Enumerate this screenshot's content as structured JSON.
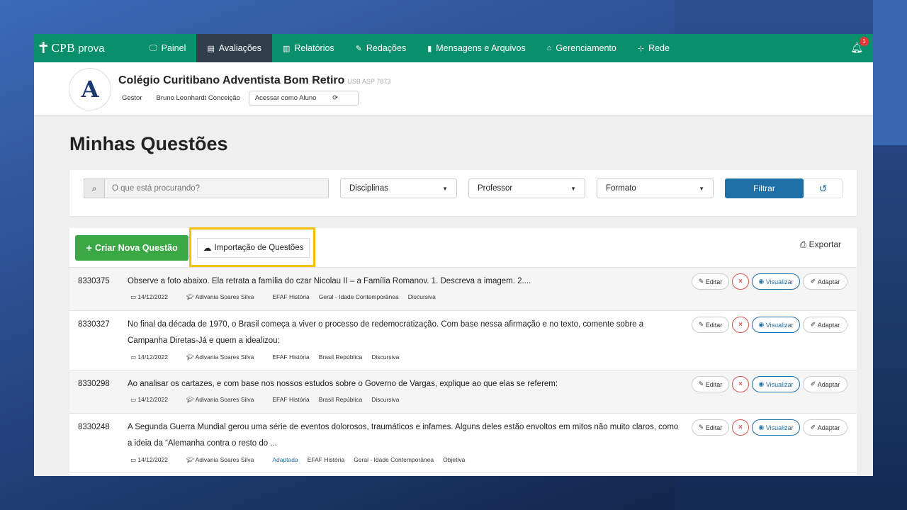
{
  "nav": {
    "logo_cpb": "CPB",
    "logo_prova": "prova",
    "items": [
      {
        "label": "Painel",
        "icon": "monitor-icon",
        "glyph": "🖵"
      },
      {
        "label": "Avaliações",
        "icon": "document-icon",
        "glyph": "▤"
      },
      {
        "label": "Relatórios",
        "icon": "bar-chart-icon",
        "glyph": "▥"
      },
      {
        "label": "Redações",
        "icon": "pencil-icon",
        "glyph": "✎"
      },
      {
        "label": "Mensagens e Arquivos",
        "icon": "book-icon",
        "glyph": "▮"
      },
      {
        "label": "Gerenciamento",
        "icon": "building-icon",
        "glyph": "⌂"
      },
      {
        "label": "Rede",
        "icon": "sitemap-icon",
        "glyph": "⊹"
      }
    ],
    "notification_count": "1",
    "accent": "#0a8f6b"
  },
  "school": {
    "name": "Colégio Curitibano Adventista Bom Retiro",
    "code": "USB ASP 7873",
    "role": "Gestor",
    "user": "Bruno Leonhardt Conceição",
    "access_button": "Acessar como Aluno"
  },
  "page": {
    "title": "Minhas Questões"
  },
  "filters": {
    "search_placeholder": "O que está procurando?",
    "disciplinas": "Disciplinas",
    "professor": "Professor",
    "formato": "Formato",
    "filter_button": "Filtrar"
  },
  "actions": {
    "create": "Criar Nova Questão",
    "import": "Importação de Questões",
    "export": "Exportar"
  },
  "row_buttons": {
    "edit": "Editar",
    "delete": "×",
    "view": "Visualizar",
    "adapt": "Adaptar"
  },
  "questions": [
    {
      "id": "8330375",
      "text": "Observe a foto abaixo. Ela retrata a família do czar Nicolau II – a Família Romanov.   1. Descreva a imagem.  2....",
      "date": "14/12/2022",
      "author": "Adivania Soares Silva",
      "adapted": "",
      "subject": "EFAF História",
      "topic": "Geral - Idade Contemporânea",
      "format": "Discursiva"
    },
    {
      "id": "8330327",
      "text": "No final da década de 1970, o Brasil começa a viver o processo de redemocratização. Com base nessa afirmação e no texto, comente sobre a Campanha Diretas-Já e quem a idealizou:",
      "date": "14/12/2022",
      "author": "Adivania Soares Silva",
      "adapted": "",
      "subject": "EFAF História",
      "topic": "Brasil República",
      "format": "Discursiva"
    },
    {
      "id": "8330298",
      "text": "Ao analisar os cartazes, e com base nos nossos estudos sobre o Governo de Vargas, explique ao que elas se referem:",
      "date": "14/12/2022",
      "author": "Adivania Soares Silva",
      "adapted": "",
      "subject": "EFAF História",
      "topic": "Brasil República",
      "format": "Discursiva"
    },
    {
      "id": "8330248",
      "text": " A Segunda Guerra Mundial gerou uma série de eventos dolorosos, traumáticos e infames. Alguns deles estão envoltos em mitos não muito claros, como a ideia da “Alemanha contra o resto do ...",
      "date": "14/12/2022",
      "author": "Adivania Soares Silva",
      "adapted": "Adaptada",
      "subject": "EFAF História",
      "topic": "Geral - Idade Contemporânea",
      "format": "Objetiva"
    }
  ]
}
